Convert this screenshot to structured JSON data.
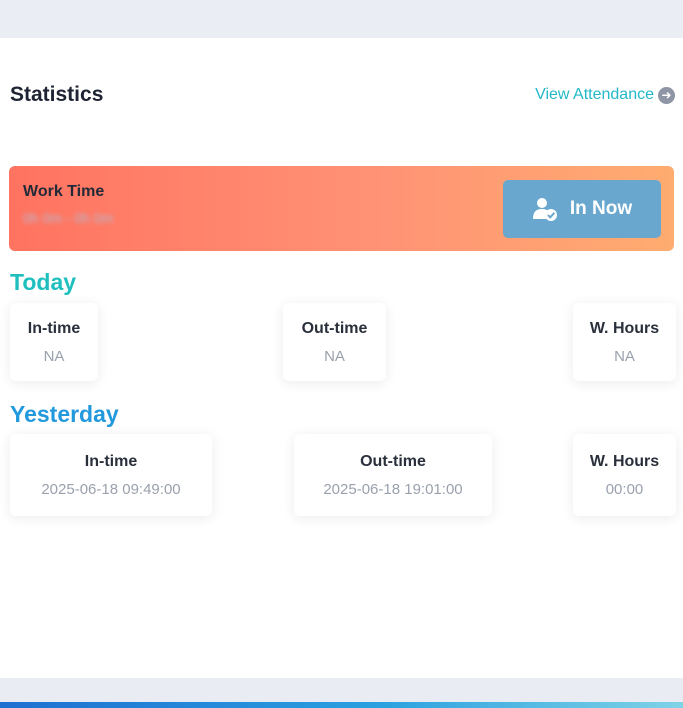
{
  "header": {
    "title": "Statistics",
    "view_link": "View Attendance"
  },
  "work_time": {
    "label": "Work Time",
    "sub_blurred": "0h 0m - 0h 0m",
    "button_label": "In Now"
  },
  "today": {
    "title": "Today",
    "in_time_label": "In-time",
    "in_time_value": "NA",
    "out_time_label": "Out-time",
    "out_time_value": "NA",
    "hours_label": "W. Hours",
    "hours_value": "NA"
  },
  "yesterday": {
    "title": "Yesterday",
    "in_time_label": "In-time",
    "in_time_value": "2025-06-18 09:49:00",
    "out_time_label": "Out-time",
    "out_time_value": "2025-06-18 19:01:00",
    "hours_label": "W. Hours",
    "hours_value": "00:00"
  },
  "icons": {
    "view_arrow": "arrow-right-circle-icon",
    "in_now": "user-check-icon"
  },
  "colors": {
    "accent_teal": "#22b8c7",
    "today_title": "#1fbfc0",
    "yesterday_title": "#2399dd",
    "button_blue": "#6aa7cf",
    "banner_start": "#ff7360",
    "banner_end": "#ffac70"
  }
}
